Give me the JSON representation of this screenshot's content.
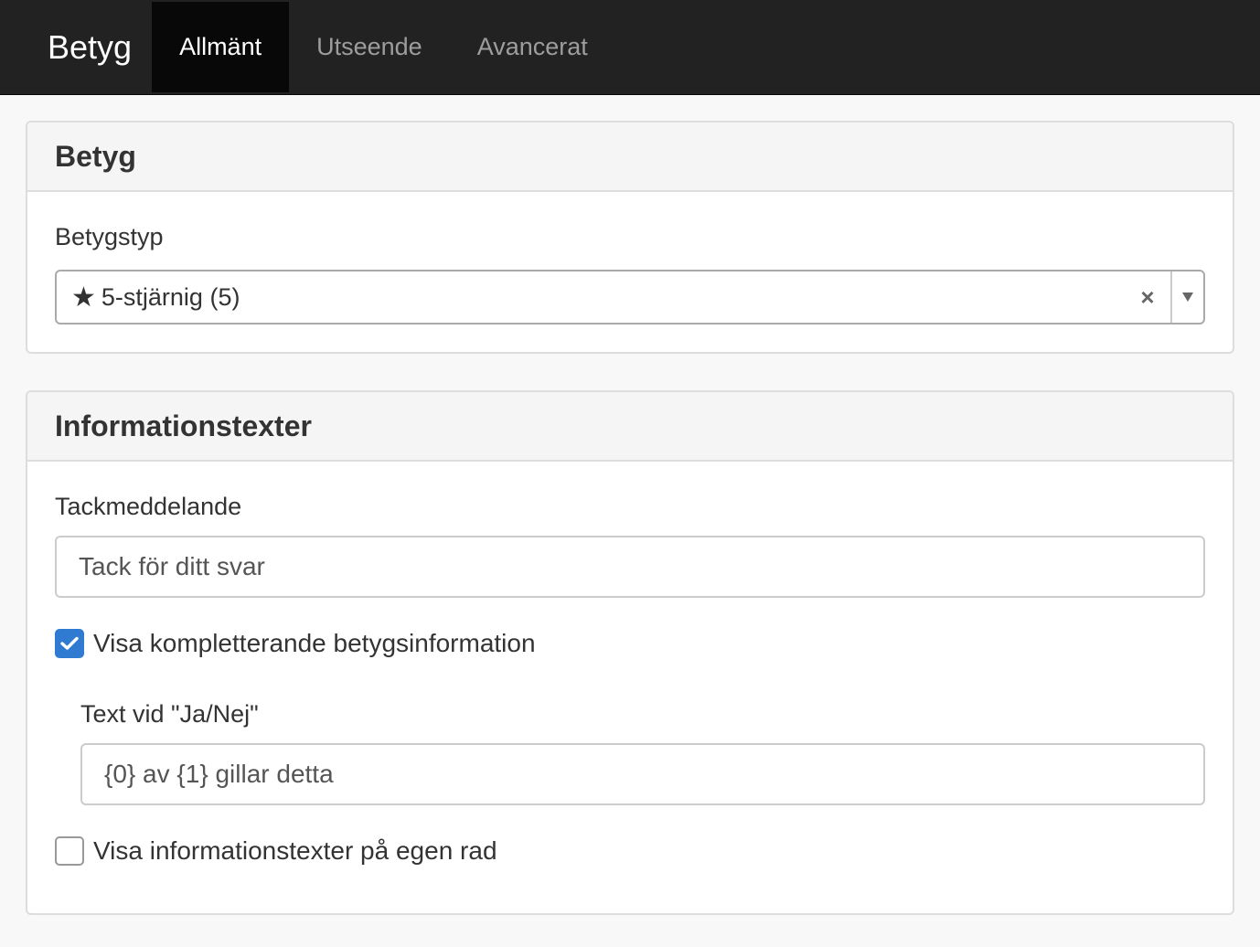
{
  "nav": {
    "brand": "Betyg",
    "tabs": [
      {
        "label": "Allmänt",
        "active": true
      },
      {
        "label": "Utseende",
        "active": false
      },
      {
        "label": "Avancerat",
        "active": false
      }
    ]
  },
  "rating_panel": {
    "title": "Betyg",
    "type_label": "Betygstyp",
    "type_icon": "star-icon",
    "type_value": "5-stjärnig (5)",
    "clear_symbol": "×"
  },
  "info_panel": {
    "title": "Informationstexter",
    "thanks_label": "Tackmeddelande",
    "thanks_value": "Tack för ditt svar",
    "show_extra_label": "Visa kompletterande betygsinformation",
    "show_extra_checked": true,
    "yesno_label": "Text vid \"Ja/Nej\"",
    "yesno_value": "{0} av {1} gillar detta",
    "own_row_label": "Visa informationstexter på egen rad",
    "own_row_checked": false
  },
  "colors": {
    "navbar_bg": "#222222",
    "active_tab_bg": "#080808",
    "checkbox_checked": "#2f7bd1"
  }
}
